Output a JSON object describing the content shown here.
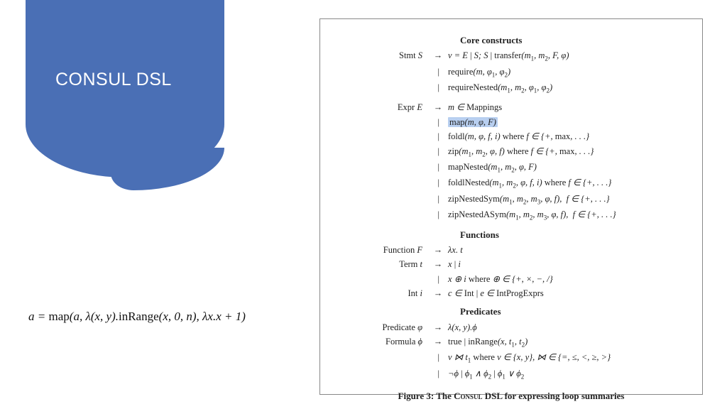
{
  "title": "CONSUL DSL",
  "equation": "a = map(a, λ(x, y).inRange(x, 0, n), λx.x + 1)",
  "figure": {
    "sections": {
      "core": "Core constructs",
      "functions": "Functions",
      "predicates": "Predicates"
    },
    "grammar": {
      "stmt_lhs": "Stmt S",
      "stmt1": "v = E | S; S | transfer(m₁, m₂, F, φ)",
      "stmt2": "require(m, φ₁, φ₂)",
      "stmt3": "requireNested(m₁, m₂, φ₁, φ₂)",
      "expr_lhs": "Expr E",
      "expr1": "m ∈ Mappings",
      "expr2": "map(m, φ, F)",
      "expr3": "foldl(m, φ, f, i) where f ∈ {+, max, . . .}",
      "expr4": "zip(m₁, m₂, φ, f) where f ∈ {+, max, . . .}",
      "expr5": "mapNested(m₁, m₂, φ, F)",
      "expr6": "foldlNested(m₁, m₂, φ, f, i) where f ∈ {+, . . .}",
      "expr7": "zipNestedSym(m₁, m₂, m₃, φ, f),  f ∈ {+, . . .}",
      "expr8": "zipNestedASym(m₁, m₂, m₃, φ, f),  f ∈ {+, . . .}",
      "func_lhs": "Function F",
      "func1": "λx. t",
      "term_lhs": "Term t",
      "term1": "x | i",
      "term2": "x ⊕ i where ⊕ ∈ {+, ×, −, /}",
      "int_lhs": "Int i",
      "int1": "c ∈ Int | e ∈ IntProgExprs",
      "pred_lhs": "Predicate φ",
      "pred1": "λ(x, y).ϕ",
      "form_lhs": "Formula ϕ",
      "form1": "true | inRange(x, t₁, t₂)",
      "form2": "v ⋈ t₁ where v ∈ {x, y}, ⋈ ∈ {=, ≤, <, ≥, >}",
      "form3": "¬ϕ | ϕ₁ ∧ ϕ₂ | ϕ₁ ∨ ϕ₂"
    },
    "caption_prefix": "Figure 3: The ",
    "caption_name": "Consul",
    "caption_suffix": " DSL for expressing loop summaries"
  }
}
